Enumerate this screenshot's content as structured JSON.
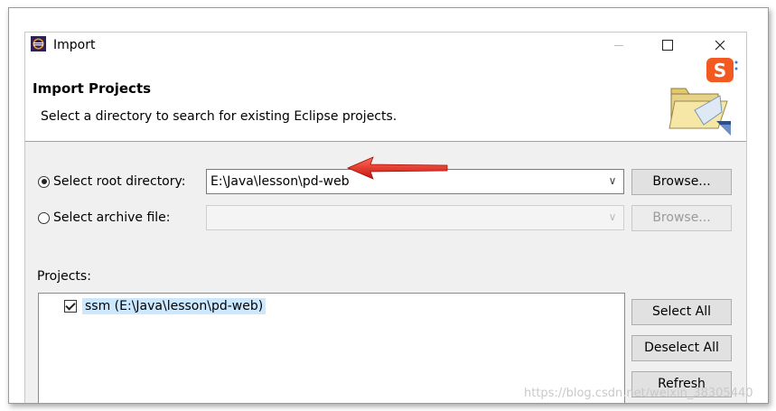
{
  "window": {
    "title": "Import",
    "controls": {
      "minimize": "—",
      "maximize": "□",
      "close": "✕"
    }
  },
  "header": {
    "title": "Import Projects",
    "description": "Select a directory to search for existing Eclipse projects."
  },
  "root_directory": {
    "label": "Select root directory:",
    "selected": true,
    "value": "E:\\Java\\lesson\\pd-web",
    "browse_label": "Browse..."
  },
  "archive_file": {
    "label": "Select archive file:",
    "selected": false,
    "value": "",
    "browse_label": "Browse..."
  },
  "projects": {
    "label": "Projects:",
    "items": [
      {
        "label": "ssm (E:\\Java\\lesson\\pd-web)",
        "checked": true
      }
    ]
  },
  "actions": {
    "select_all": "Select All",
    "deselect_all": "Deselect All",
    "refresh": "Refresh"
  },
  "watermark": "https://blog.csdn.net/weixin_38305440",
  "colors": {
    "annotation_arrow": "#e0201b",
    "selection": "#cce8ff",
    "ime_logo": "#f35a21"
  },
  "icons": {
    "app": "eclipse-icon",
    "header": "folder-icon",
    "ime": "sogou-ime-icon",
    "annotation": "red-arrow-icon"
  }
}
